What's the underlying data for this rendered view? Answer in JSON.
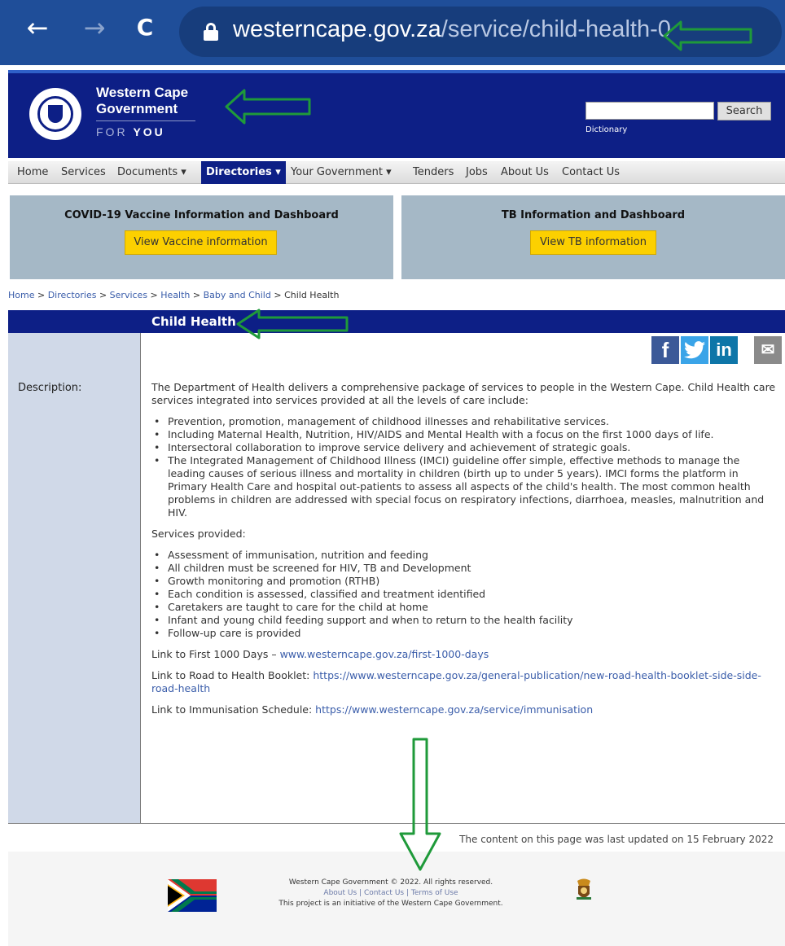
{
  "browser": {
    "back_icon": "←",
    "forward_icon": "→",
    "reload_icon": "C",
    "url_host": "westerncape.gov.za",
    "url_path": "/service/child-health-0"
  },
  "header": {
    "brand_line1": "Western Cape",
    "brand_line2": "Government",
    "tagline_for": "FOR ",
    "tagline_you": "YOU",
    "search_placeholder": "",
    "search_button": "Search",
    "dictionary": "Dictionary"
  },
  "nav": {
    "items": [
      "Home",
      "Services",
      "Documents ▾",
      "Directories ▾",
      "Your Government ▾",
      "Tenders",
      "Jobs",
      "About Us",
      "Contact Us"
    ]
  },
  "banners": [
    {
      "title": "COVID-19 Vaccine Information and Dashboard",
      "button": "View Vaccine information"
    },
    {
      "title": "TB Information and Dashboard",
      "button": "View TB information"
    }
  ],
  "breadcrumb": {
    "items": [
      "Home",
      "Directories",
      "Services",
      "Health",
      "Baby and Child"
    ],
    "current": "Child Health",
    "separator": " > "
  },
  "page": {
    "title": "Child Health",
    "description_label": "Description:",
    "intro": "The Department of Health delivers a comprehensive package of services to people in the Western Cape. Child Health care services integrated into services provided at all the levels of care include:",
    "bullets1": [
      "Prevention, promotion, management of childhood illnesses and rehabilitative services.",
      "Including Maternal Health, Nutrition, HIV/AIDS and Mental Health with a focus on the first 1000 days of life.",
      "Intersectoral collaboration to improve service delivery and achievement of strategic goals.",
      "The Integrated Management of Childhood Illness (IMCI) guideline offer simple, effective methods to manage the leading causes of serious illness and mortality in children (birth up to under 5 years). IMCI forms the platform in Primary Health Care and hospital out-patients to assess all aspects of the child's health. The most common health problems in children are addressed with special focus on respiratory infections, diarrhoea, measles, malnutrition and HIV."
    ],
    "services_heading": "Services provided:",
    "bullets2": [
      "Assessment of immunisation, nutrition and feeding",
      "All children must be screened for HIV, TB and Development",
      "Growth monitoring and promotion (RTHB)",
      "Each condition is assessed, classified and treatment identified",
      "Caretakers are taught to care for the child at home",
      "Infant and young child feeding support and when to return to the health facility",
      "Follow-up care is provided"
    ],
    "link1_label": "Link to First 1000 Days – ",
    "link1_url": "www.westerncape.gov.za/first-1000-days",
    "link2_label": "Link to Road to Health Booklet: ",
    "link2_url": "https://www.westerncape.gov.za/general-publication/new-road-health-booklet-side-side-road-health",
    "link3_label": "Link to Immunisation Schedule: ",
    "link3_url": "https://www.westerncape.gov.za/service/immunisation",
    "last_updated": "The content on this page was last updated on 15 February 2022"
  },
  "social": [
    {
      "icon": "facebook-icon",
      "glyph": "f",
      "color": "#3b5998"
    },
    {
      "icon": "twitter-icon",
      "glyph": "t",
      "color": "#3aa4e8"
    },
    {
      "icon": "linkedin-icon",
      "glyph": "in",
      "color": "#0e76a8"
    },
    {
      "icon": "email-icon",
      "glyph": "✉",
      "color": "#8a8a8a"
    }
  ],
  "footer": {
    "copyright": "Western Cape Government © 2022. All rights reserved.",
    "links": [
      "About Us",
      "Contact Us",
      "Terms of Use"
    ],
    "link_separator": " | ",
    "initiative": "This project is an initiative of the Western Cape Government."
  },
  "colors": {
    "navy": "#0d1f86",
    "annotation_green": "#1f9a3a",
    "banner_bg": "#a5b8c6",
    "button_yellow": "#fcd000"
  }
}
